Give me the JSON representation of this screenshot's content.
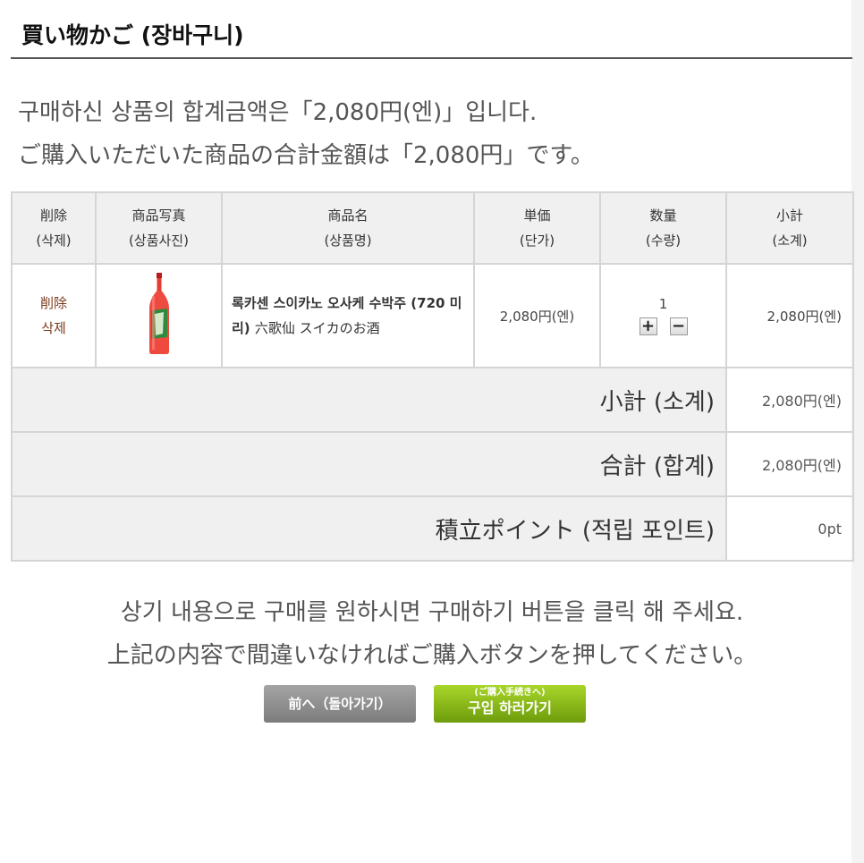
{
  "header": {
    "title": "買い物かご (장바구니)"
  },
  "notice": {
    "korean": "구매하신 상품의 합계금액은「2,080円(엔)」입니다.",
    "japanese": "ご購入いただいた商品の合計金額は「2,080円」です。"
  },
  "table": {
    "headers": [
      {
        "jp": "削除",
        "kr": "(삭제)"
      },
      {
        "jp": "商品写真",
        "kr": "(상품사진)"
      },
      {
        "jp": "商品名",
        "kr": "(상품명)"
      },
      {
        "jp": "単価",
        "kr": "(단가)"
      },
      {
        "jp": "数量",
        "kr": "(수량)"
      },
      {
        "jp": "小計",
        "kr": "(소계)"
      }
    ],
    "item": {
      "delete_jp": "削除",
      "delete_kr": "삭제",
      "image_icon": "red-bottle-icon",
      "name_kr": "록카센 스이카노 오사케 수박주 (720 미리)",
      "name_jp": "六歌仙 スイカのお酒",
      "unit_price": "2,080円(엔)",
      "quantity": "1",
      "plus_label": "+",
      "minus_label": "−",
      "subtotal": "2,080円(엔)"
    },
    "summary": [
      {
        "label": "小計 (소계)",
        "value": "2,080円(엔)"
      },
      {
        "label": "合計 (합계)",
        "value": "2,080円(엔)"
      },
      {
        "label": "積立ポイント (적립 포인트)",
        "value": "0pt"
      }
    ]
  },
  "confirm": {
    "korean": "상기 내용으로 구매를 원하시면 구매하기 버튼을 클릭 해 주세요.",
    "japanese": "上記の内容で間違いなければご購入ボタンを押してください。"
  },
  "buttons": {
    "back": "前へ（돌아가기）",
    "buy_small": "(ご購入手続きへ)",
    "buy_main": "구입 하러가기"
  },
  "colors": {
    "delete_link": "#7a3b1a",
    "header_bg": "#f0f0f0",
    "buy_button": "#8cbf1a",
    "back_button": "#8f8f8f"
  }
}
